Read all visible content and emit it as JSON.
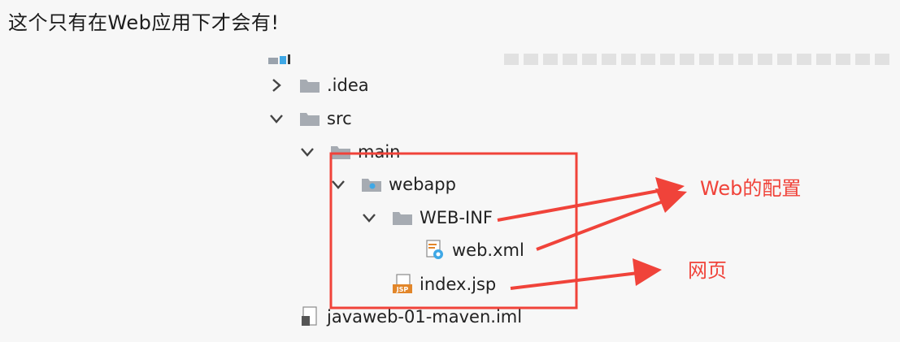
{
  "heading": "这个只有在Web应用下才会有!",
  "tree": [
    {
      "label": ".idea",
      "expanded": false,
      "icon": "folder-icon"
    },
    {
      "label": "src",
      "expanded": true,
      "icon": "folder-icon"
    },
    {
      "label": "main",
      "expanded": true,
      "icon": "folder-icon"
    },
    {
      "label": "webapp",
      "expanded": true,
      "icon": "web-folder-icon"
    },
    {
      "label": "WEB-INF",
      "expanded": true,
      "icon": "folder-icon"
    },
    {
      "label": "web.xml",
      "icon": "xml-config-file-icon"
    },
    {
      "label": "index.jsp",
      "icon": "jsp-file-icon",
      "icon_text": "JSP"
    },
    {
      "label": "javaweb-01-maven.iml",
      "icon": "iml-file-icon"
    }
  ],
  "annotations": {
    "web_config": "Web的配置",
    "web_page": "网页"
  },
  "colors": {
    "annotation": "#f0433a",
    "folder": "#a6abb2",
    "web_folder_dot": "#3fa8e6",
    "jsp_badge": "#e2862a",
    "background": "#f7f7f7"
  }
}
